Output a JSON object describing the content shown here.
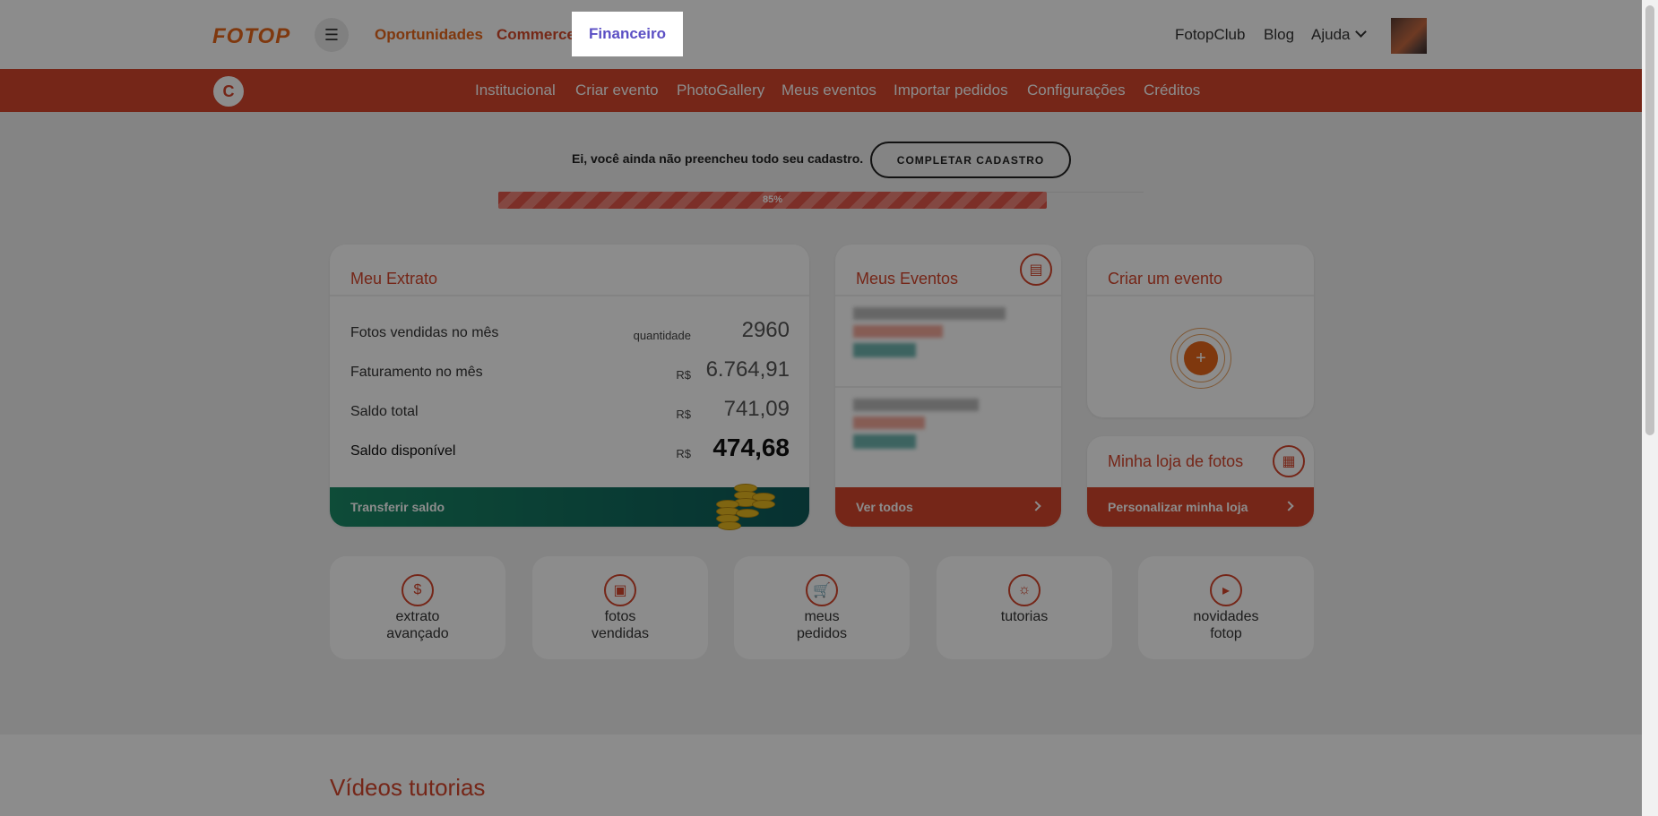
{
  "header": {
    "logo": "FOTOP",
    "menu_icon": "hamburger-icon",
    "nav": [
      "Oportunidades",
      "Commerce",
      "Financeiro"
    ],
    "active_nav": "Financeiro",
    "right_links": [
      "FotopClub",
      "Blog",
      "Ajuda"
    ]
  },
  "subnav": {
    "user_initial": "C",
    "items": [
      "Institucional",
      "Criar evento",
      "PhotoGallery",
      "Meus eventos",
      "Importar pedidos",
      "Configurações",
      "Créditos"
    ]
  },
  "profile": {
    "message": "Ei, você ainda não preencheu todo seu cadastro.",
    "button": "COMPLETAR CADASTRO",
    "progress_label": "85%",
    "progress_value": 85
  },
  "extrato": {
    "title": "Meu Extrato",
    "rows": [
      {
        "label": "Fotos vendidas no mês",
        "unit": "quantidade",
        "value": "2960"
      },
      {
        "label": "Faturamento no mês",
        "unit": "R$",
        "value": "6.764,91"
      },
      {
        "label": "Saldo total",
        "unit": "R$",
        "value": "741,09"
      },
      {
        "label": "Saldo disponível",
        "unit": "R$",
        "value": "474,68"
      }
    ],
    "footer": "Transferir saldo"
  },
  "eventos": {
    "title": "Meus Eventos",
    "footer": "Ver todos"
  },
  "criar": {
    "title": "Criar um evento"
  },
  "loja": {
    "title": "Minha loja de fotos",
    "footer": "Personalizar minha loja"
  },
  "quick": [
    {
      "line1": "extrato",
      "line2": "avançado",
      "icon": "dollar-icon"
    },
    {
      "line1": "fotos",
      "line2": "vendidas",
      "icon": "photo-icon"
    },
    {
      "line1": "meus",
      "line2": "pedidos",
      "icon": "cart-icon"
    },
    {
      "line1": "tutorias",
      "line2": "",
      "icon": "lightbulb-icon"
    },
    {
      "line1": "novidades",
      "line2": "fotop",
      "icon": "megaphone-icon"
    }
  ],
  "tutorials": {
    "title": "Vídeos tutorias"
  },
  "colors": {
    "brand_orange": "#e8661a",
    "brand_red": "#d5462c",
    "active_purple": "#5b4fc4",
    "green": "#1a8a66"
  }
}
